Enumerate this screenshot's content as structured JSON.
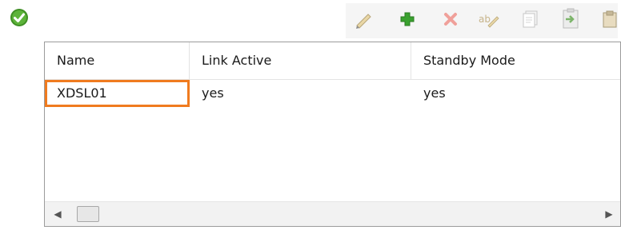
{
  "status": {
    "icon": "check-circle-icon",
    "color": "#4a9a2a"
  },
  "toolbar": {
    "buttons": [
      {
        "name": "edit-button",
        "icon": "pencil-icon"
      },
      {
        "name": "add-button",
        "icon": "plus-icon",
        "color": "#3aa12f"
      },
      {
        "name": "delete-button",
        "icon": "close-icon",
        "color": "#e0463a"
      },
      {
        "name": "rename-button",
        "icon": "rename-icon"
      },
      {
        "name": "copy-button",
        "icon": "copy-icon"
      },
      {
        "name": "paste-button",
        "icon": "paste-icon"
      },
      {
        "name": "clipboard-button",
        "icon": "clipboard-icon"
      }
    ]
  },
  "table": {
    "columns": [
      "Name",
      "Link Active",
      "Standby Mode"
    ],
    "rows": [
      {
        "name": "XDSL01",
        "link_active": "yes",
        "standby_mode": "yes",
        "selected": true
      }
    ],
    "selection_color": "#f07b1f"
  },
  "scrollbar": {
    "left_arrow": "◀",
    "right_arrow": "▶"
  }
}
